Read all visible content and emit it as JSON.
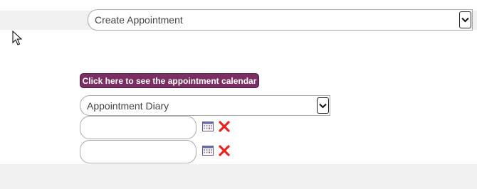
{
  "appointment_type": {
    "selected": "Create Appointment"
  },
  "calendar_button": {
    "label": "Click here to see the appointment calendar"
  },
  "diary_select": {
    "selected": "Appointment Diary"
  },
  "date_from": {
    "value": ""
  },
  "date_to": {
    "value": ""
  },
  "colors": {
    "button_bg": "#7a2f62",
    "band_bg": "#f0f0f0",
    "clear_icon": "#e8231f"
  }
}
